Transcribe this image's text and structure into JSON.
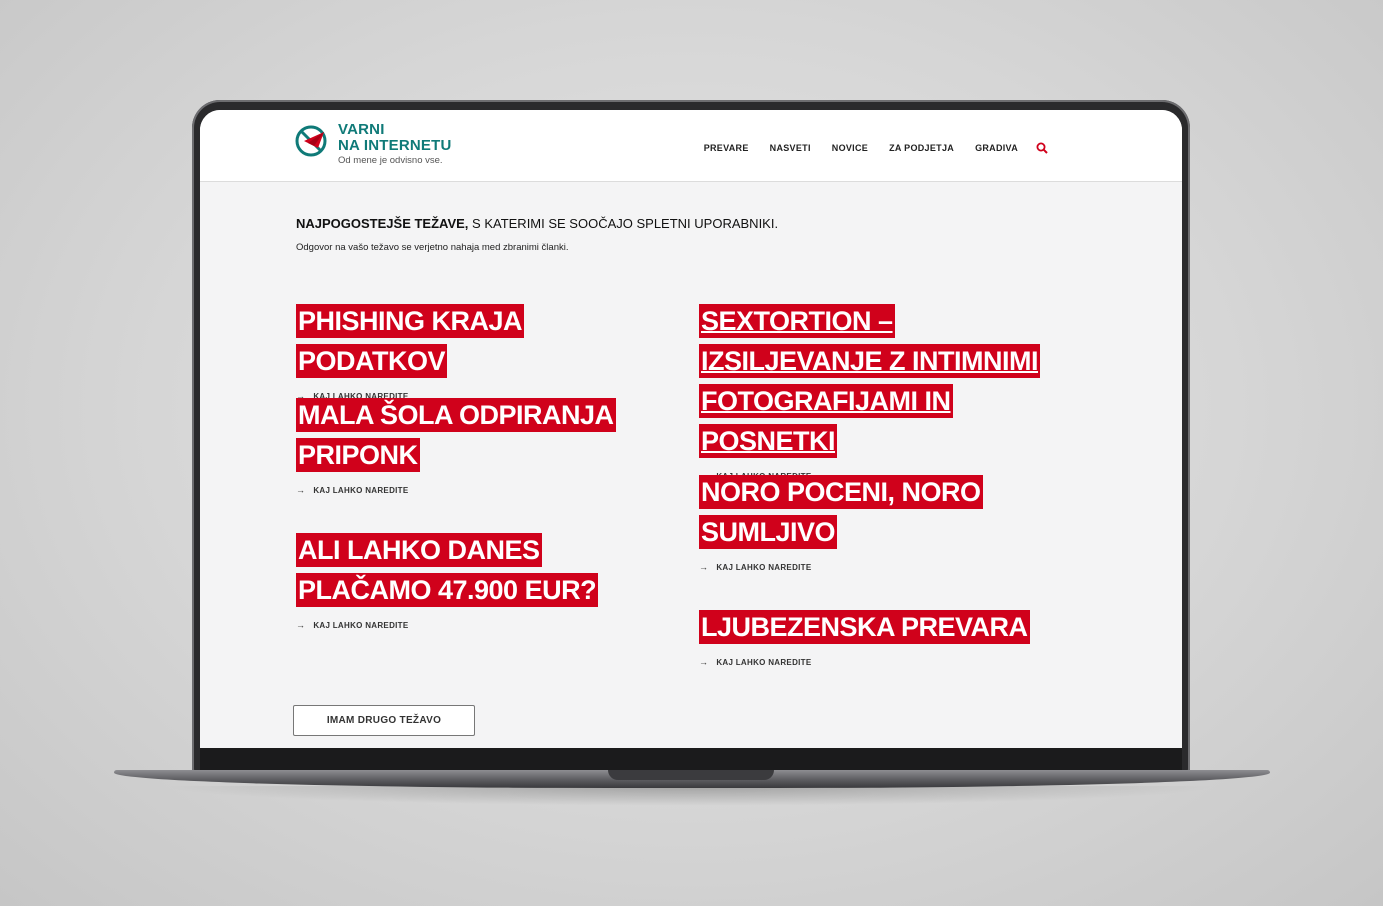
{
  "site": {
    "logo_line1": "VARNI",
    "logo_line2": "NA INTERNETU",
    "tagline": "Od mene je odvisno vse."
  },
  "nav": {
    "items": [
      "PREVARE",
      "NASVETI",
      "NOVICE",
      "ZA PODJETJA",
      "GRADIVA"
    ],
    "search_icon": "search-icon"
  },
  "intro": {
    "heading_bold": "NAJPOGOSTEJŠE TEŽAVE,",
    "heading_rest": " S KATERIMI SE SOOČAJO SPLETNI UPORABNIKI.",
    "subtitle": "Odgovor na vašo težavo se verjetno nahaja med zbranimi članki."
  },
  "cards_left": [
    {
      "title": "PHISHING KRAJA PODATKOV",
      "link": "KAJ LAHKO NAREDITE"
    },
    {
      "title": "MALA ŠOLA ODPIRANJA PRIPONK",
      "link": "KAJ LAHKO NAREDITE"
    },
    {
      "title": "ALI LAHKO DANES PLAČAMO 47.900 EUR?",
      "link": "KAJ LAHKO NAREDITE"
    }
  ],
  "cards_right": [
    {
      "title": "SEXTORTION – IZSILJEVANJE Z INTIMNIMI FOTOGRAFIJAMI IN POSNETKI",
      "link": "KAJ LAHKO NAREDITE"
    },
    {
      "title": "NORO POCENI, NORO SUMLJIVO",
      "link": "KAJ LAHKO NAREDITE"
    },
    {
      "title": "LJUBEZENSKA PREVARA",
      "link": "KAJ LAHKO NAREDITE"
    }
  ],
  "other_button": "IMAM DRUGO TEŽAVO",
  "colors": {
    "accent_red": "#d0011b",
    "logo_teal": "#0f7a78"
  }
}
